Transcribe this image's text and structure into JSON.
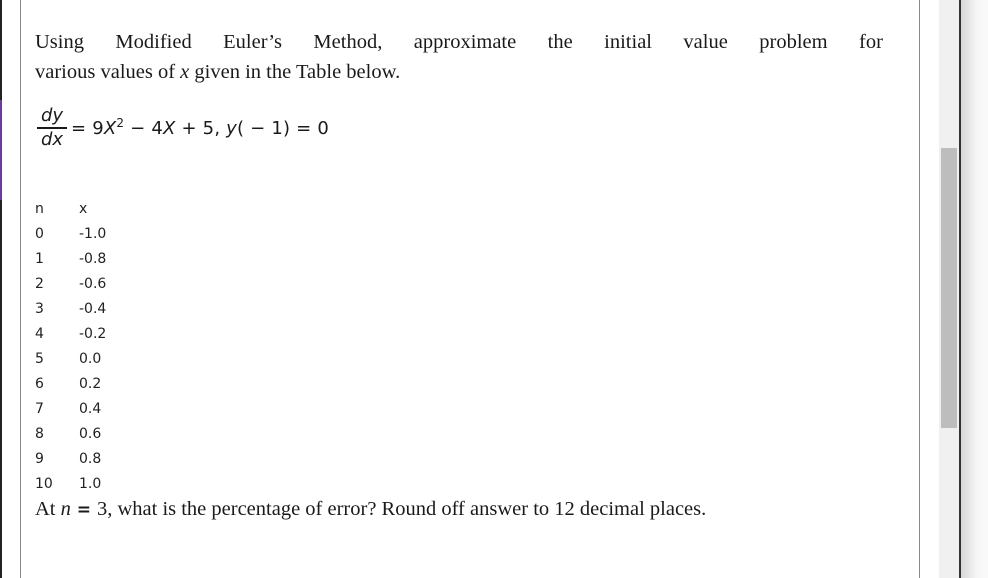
{
  "intro": {
    "line1_words": [
      "Using",
      "Modified",
      "Euler’s",
      "Method,",
      "approximate",
      "the",
      "initial",
      "value",
      "problem",
      "for"
    ],
    "line2_pre": "various values of ",
    "line2_var": "x",
    "line2_post": " given in the Table below."
  },
  "equation": {
    "numerator": "dy",
    "denominator": "dx",
    "rhs_pre": "= 9",
    "var1": "X",
    "exp1": "2",
    "rhs_mid": " − 4",
    "var2": "X",
    "rhs_post1": " + 5, ",
    "ivar": "y",
    "rhs_post2": "( − 1) = 0"
  },
  "table": {
    "headers": {
      "n": "n",
      "x": "x"
    },
    "rows": [
      {
        "n": "0",
        "x": "-1.0"
      },
      {
        "n": "1",
        "x": "-0.8"
      },
      {
        "n": "2",
        "x": "-0.6"
      },
      {
        "n": "3",
        "x": "-0.4"
      },
      {
        "n": "4",
        "x": "-0.2"
      },
      {
        "n": "5",
        "x": "0.0"
      },
      {
        "n": "6",
        "x": "0.2"
      },
      {
        "n": "7",
        "x": "0.4"
      },
      {
        "n": "8",
        "x": "0.6"
      },
      {
        "n": "9",
        "x": "0.8"
      },
      {
        "n": "10",
        "x": "1.0"
      }
    ]
  },
  "question": {
    "pre": "At ",
    "var": "n",
    "eq": " = ",
    "post": "3, what is the percentage of error?  Round off answer to 12 decimal places."
  },
  "scrollbar": {
    "position_fraction": 0.26,
    "visible_fraction": 0.48
  }
}
